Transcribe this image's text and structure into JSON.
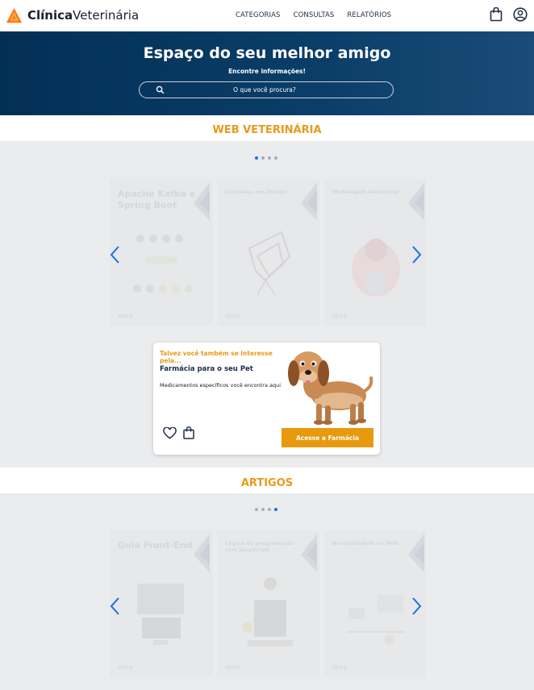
{
  "header": {
    "logo": {
      "bold": "Clínica",
      "regular": "Veterinária"
    },
    "nav": [
      "CATEGORIAS",
      "CONSULTAS",
      "RELATÓRIOS"
    ],
    "cart_icon": "shopping-bag-icon",
    "user_icon": "user-circle-icon"
  },
  "hero": {
    "title": "Espaço do seu melhor amigo",
    "subtitle": "Encontre informações!",
    "search_placeholder": "O que você procura?"
  },
  "sections": {
    "web": {
      "title": "WEB VETERINÁRIA",
      "dots_total": 4,
      "active_dot": 0,
      "cards": [
        {
          "title": "Apache Kafka e Spring Boot",
          "footer": "Alura"
        },
        {
          "title": "Liderança em Design",
          "footer": "Alura"
        },
        {
          "title": "Modelagem Relacional",
          "footer": "Alura"
        }
      ]
    },
    "artigos": {
      "title": "ARTIGOS",
      "dots_total": 4,
      "active_dot": 3,
      "cards": [
        {
          "title": "Guia Front-End",
          "footer": "Alura"
        },
        {
          "title": "Lógica de programação com JavaScript",
          "footer": "Alura"
        },
        {
          "title": "Acessibilidade na Web",
          "footer": "Alura"
        }
      ]
    }
  },
  "promo": {
    "kicker": "Talvez você também se interesse pela...",
    "title": "Farmácia para o seu Pet",
    "description": "Medicamentos específicos você encontra aqui",
    "button": "Acesse a Farmácia",
    "image": "dachshund-dog",
    "icons": [
      "heart-icon",
      "shopping-bag-icon"
    ]
  },
  "colors": {
    "accent": "#e89a1c",
    "hero": "#032f55",
    "active_dot": "#1c6ee8",
    "arrow": "#1c6ee8"
  }
}
